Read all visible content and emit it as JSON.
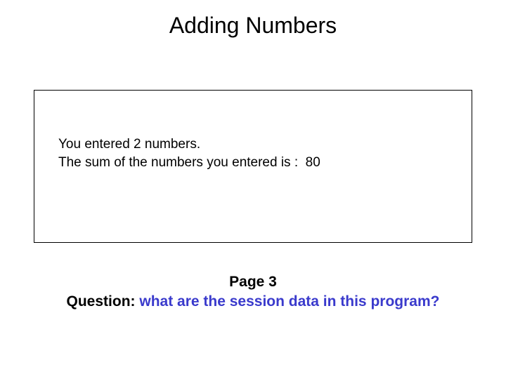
{
  "title": "Adding Numbers",
  "output": {
    "line1": "You entered 2 numbers.",
    "line2": "The sum of the numbers you entered is :  80"
  },
  "footer": {
    "page": "Page 3",
    "question_label": "Question:  ",
    "question_text": "what are the session data in this program?"
  }
}
